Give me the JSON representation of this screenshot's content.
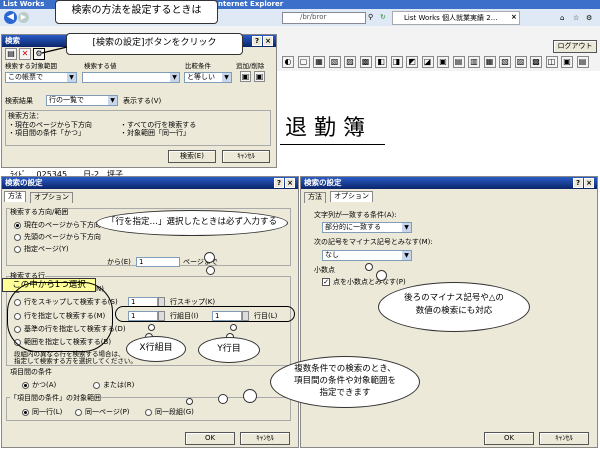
{
  "browser": {
    "tab_left": "List Works",
    "title_right": "nternet Explorer",
    "address_partial": "/br/bror",
    "tab_label": "List Works 個人就業実績 2...",
    "logout": "ログアウト"
  },
  "callouts": {
    "top": "検索の方法を設定するときは",
    "button_hint": "[検索の設定]ボタンをクリック",
    "line_spec": "「行を指定…」選択したときは必ず入力する",
    "choose_one": "この中から1つ選択",
    "x_row": "X行組目",
    "y_row": "Y行目",
    "minus": [
      "後ろのマイナス記号や△の",
      "数値の検索にも対応"
    ],
    "multi": [
      "複数条件での検索のとき、",
      "項目間の条件や対象範囲を",
      "指定できます"
    ]
  },
  "document": {
    "title": "退 勤 簿",
    "row_text": [
      "ﾗｲﾄﾞ　 025345　　日-2　坪子"
    ]
  },
  "search_dialog": {
    "title": "検索",
    "col_target": "検索する対象範囲",
    "col_value": "検索する値",
    "col_compare": "比較条件",
    "col_add": "追加/削除",
    "target_value": "この帳票で",
    "compare_value": "と等しい",
    "result_label": "検索結果",
    "result_value": "行の一覧で",
    "result_suffix": "表示する(V)",
    "method_label": "検索方法：",
    "methods_left": [
      "・現在のページから下方向",
      "・項目間の条件「かつ」"
    ],
    "methods_right": [
      "・すべての行を検索する",
      "・対象範囲「同一行」"
    ],
    "search_btn": "検索(E)",
    "cancel_btn": "ｷｬﾝｾﾙ"
  },
  "settings_left": {
    "title": "検索の設定",
    "tabs": [
      "方法",
      "オプション"
    ],
    "direction_group": "検索する方向/範囲",
    "directions": [
      "現在のページから下方向",
      "先頭のページから下方向",
      "指定ページ(Y)"
    ],
    "page_from": "から(E)",
    "page_from_val": "1",
    "page_to": "ページまで",
    "rows_group": "検索する行",
    "rows": [
      "すべての行を検索する(N)",
      "行をスキップして検索する(S)",
      "行を指定して検索する(M)",
      "基準の行を指定して検索する(D)",
      "範囲を指定して検索する(B)"
    ],
    "skip_val": "1",
    "skip_label": "行スキップ(K)",
    "row_group_val": "1",
    "row_group_label": "行組目(I)",
    "row_val": "1",
    "row_label": "行目(L)",
    "note": [
      "段組内の異なる行を検索する場合は、",
      "指定して検索する方を選択してください。"
    ],
    "cond_group": "項目間の条件",
    "conds": [
      "かつ(A)",
      "または(R)"
    ],
    "scope_group": "「項目間の条件」の対象範囲",
    "scopes": [
      "同一行(L)",
      "同一ページ(P)",
      "同一段組(G)"
    ],
    "ok": "OK",
    "cancel": "ｷｬﾝｾﾙ"
  },
  "settings_right": {
    "title": "検索の設定",
    "tabs": [
      "方法",
      "オプション"
    ],
    "match_label": "文字列が一致する条件(A):",
    "match_value": "部分的に一致する",
    "minus_label": "次の記号をマイナス記号とみなす(M):",
    "minus_value": "なし",
    "decimal_label": "小数点",
    "decimal_check": "点を小数点とみなす(P)",
    "ok": "OK",
    "cancel": "ｷｬﾝｾﾙ"
  }
}
